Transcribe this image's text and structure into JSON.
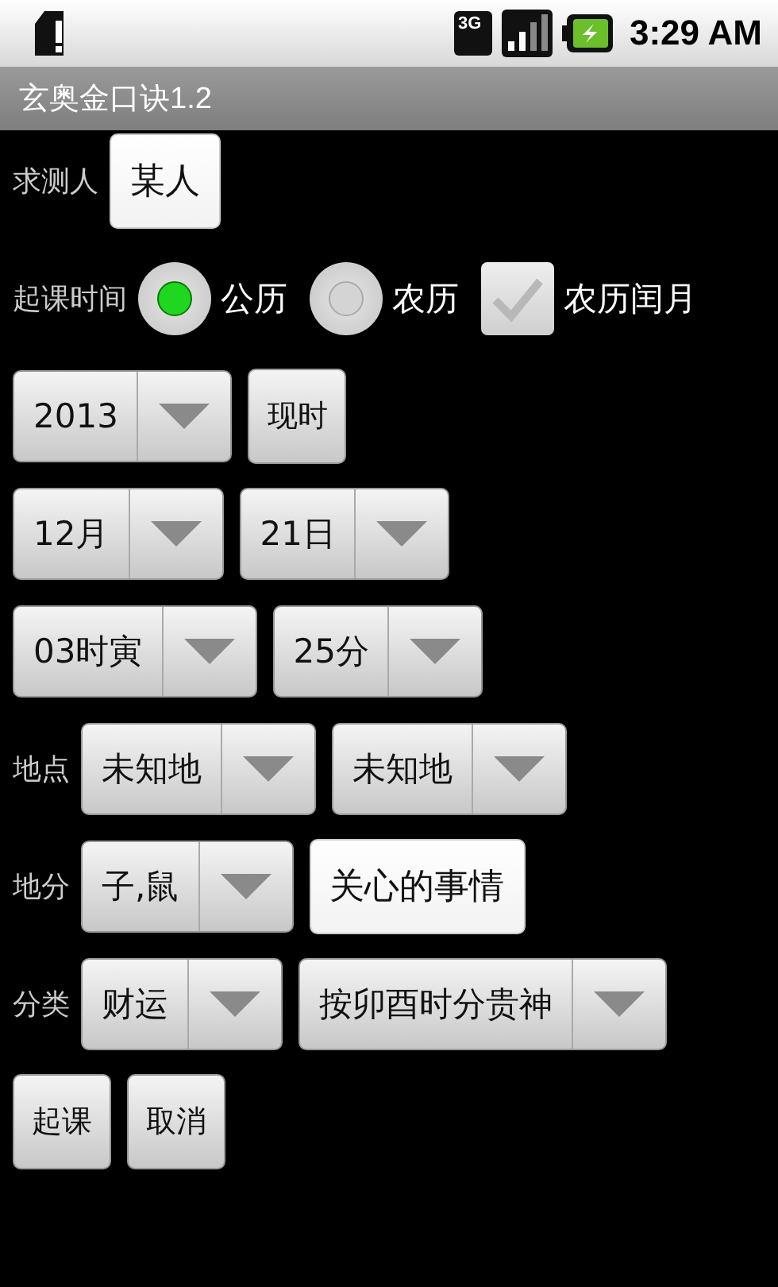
{
  "status_bar": {
    "time": "3:29 AM",
    "network": "3G"
  },
  "window": {
    "title": "玄奥金口诀1.2"
  },
  "rows": [
    {
      "items": [
        {
          "kind": "label",
          "text": "求测人"
        },
        {
          "kind": "field",
          "value": "某人"
        }
      ]
    },
    {
      "items": [
        {
          "kind": "label",
          "text": "起课时间"
        },
        {
          "kind": "radio",
          "text": "公历",
          "selected": true
        },
        {
          "kind": "radio",
          "text": "农历",
          "selected": false
        },
        {
          "kind": "checkbox",
          "text": "农历闰月",
          "checked": false
        }
      ]
    },
    {
      "items": [
        {
          "kind": "spinner",
          "value": "2013"
        },
        {
          "kind": "button",
          "text": "现时"
        }
      ]
    },
    {
      "items": [
        {
          "kind": "spinner",
          "value": "12月"
        },
        {
          "kind": "spinner",
          "value": "21日"
        }
      ]
    },
    {
      "items": [
        {
          "kind": "spinner",
          "value": "03时寅"
        },
        {
          "kind": "spinner",
          "value": "25分"
        }
      ]
    },
    {
      "items": [
        {
          "kind": "label",
          "text": "地点"
        },
        {
          "kind": "spinner",
          "value": "未知地"
        },
        {
          "kind": "spinner",
          "value": "未知地"
        }
      ]
    },
    {
      "items": [
        {
          "kind": "label",
          "text": "地分"
        },
        {
          "kind": "spinner",
          "value": "子,鼠"
        },
        {
          "kind": "field",
          "value": "关心的事情"
        }
      ]
    },
    {
      "items": [
        {
          "kind": "label",
          "text": "分类"
        },
        {
          "kind": "spinner",
          "value": "财运"
        },
        {
          "kind": "spinner",
          "value": "按卯酉时分贵神"
        }
      ]
    },
    {
      "items": [
        {
          "kind": "button",
          "text": "起课"
        },
        {
          "kind": "button",
          "text": "取消"
        }
      ]
    }
  ]
}
